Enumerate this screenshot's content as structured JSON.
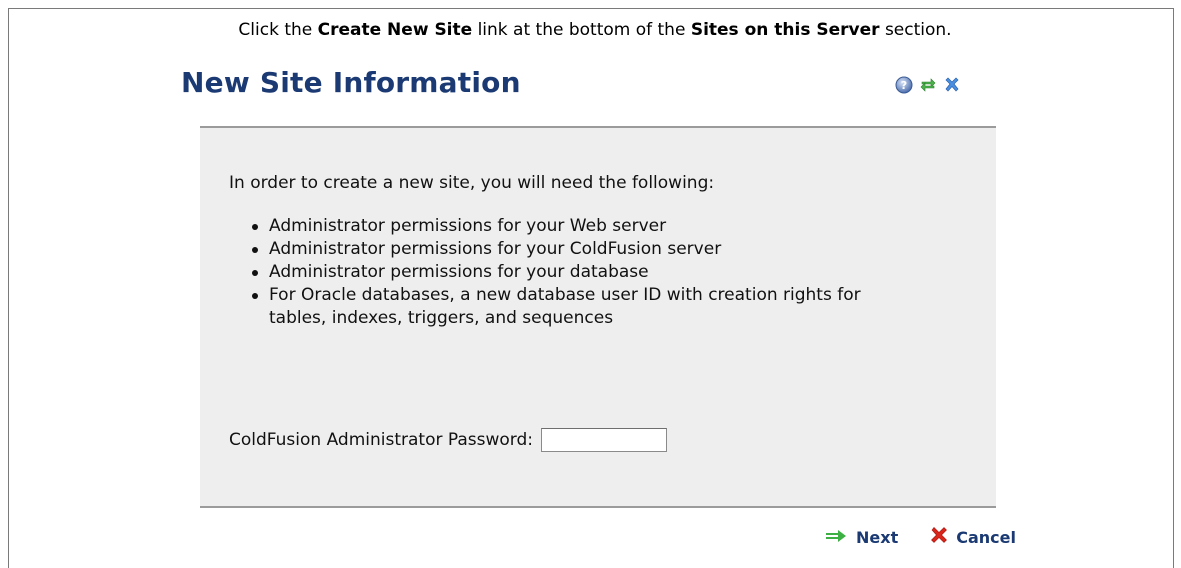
{
  "instruction": {
    "prefix": "Click the ",
    "link_name": "Create New Site",
    "middle": " link at the bottom of the ",
    "section_name": "Sites on this Server",
    "suffix": " section."
  },
  "dialog": {
    "title": "New Site Information",
    "icons": [
      "help-icon",
      "refresh-icon",
      "close-icon"
    ],
    "intro": "In order to create a new site, you will need the following:",
    "requirements": [
      "Administrator permissions for your Web server",
      "Administrator permissions for your ColdFusion server",
      "Administrator permissions for your database",
      "For Oracle databases, a new database user ID with creation rights for tables, indexes, triggers, and sequences"
    ],
    "password_label": "ColdFusion Administrator Password:",
    "password_value": "",
    "next_label": "Next",
    "cancel_label": "Cancel"
  },
  "colors": {
    "title": "#1b3a73",
    "panel": "#eeeeee",
    "next_arrow": "#3cb043",
    "cancel_x": "#d9261c"
  }
}
